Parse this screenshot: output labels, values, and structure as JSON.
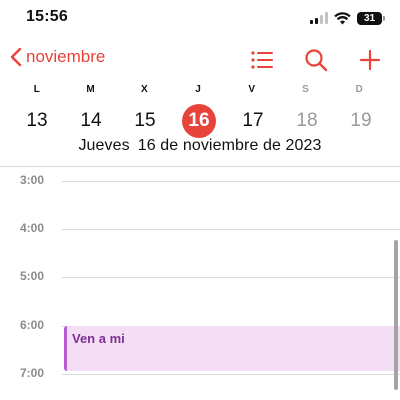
{
  "status_bar": {
    "time": "15:56",
    "battery": "31"
  },
  "nav": {
    "back_label": "noviembre",
    "icons": [
      "chevron-left-icon",
      "list-icon",
      "search-icon",
      "plus-icon"
    ],
    "accent_color": "#e8433a"
  },
  "week": {
    "letters": [
      "L",
      "M",
      "X",
      "J",
      "V",
      "S",
      "D"
    ],
    "days": [
      "13",
      "14",
      "15",
      "16",
      "17",
      "18",
      "19"
    ],
    "selected_index": 3
  },
  "full_date": {
    "weekday": "Jueves",
    "date": "16 de noviembre de 2023"
  },
  "timeline": {
    "hours": [
      "3:00",
      "4:00",
      "5:00",
      "6:00",
      "7:00"
    ]
  },
  "events": [
    {
      "title": "Ven a mi",
      "color": "#b65cd1"
    }
  ]
}
